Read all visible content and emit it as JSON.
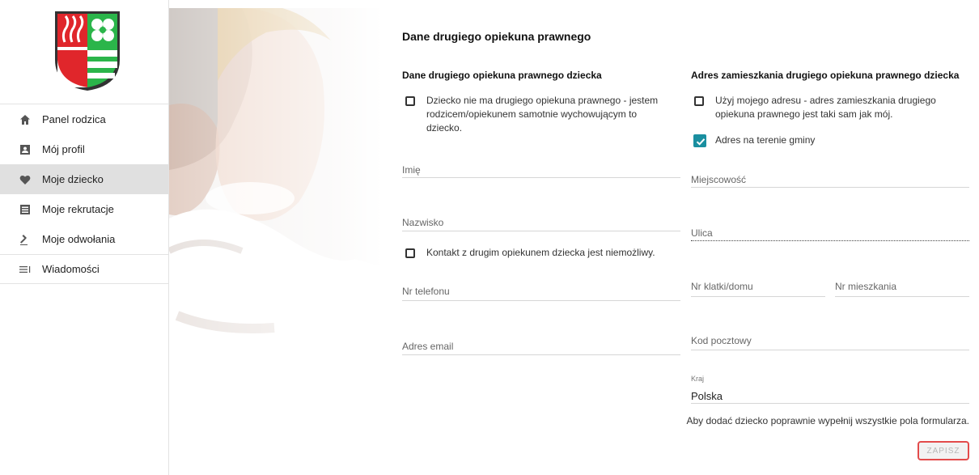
{
  "sidebar": {
    "items": [
      {
        "label": "Panel rodzica",
        "icon": "home-icon"
      },
      {
        "label": "Mój profil",
        "icon": "profile-icon"
      },
      {
        "label": "Moje dziecko",
        "icon": "heart-icon"
      },
      {
        "label": "Moje rekrutacje",
        "icon": "list-icon"
      },
      {
        "label": "Moje odwołania",
        "icon": "gavel-icon"
      },
      {
        "label": "Wiadomości",
        "icon": "messages-icon"
      }
    ]
  },
  "form": {
    "title": "Dane drugiego opiekuna prawnego",
    "left": {
      "subtitle": "Dane drugiego opiekuna prawnego dziecka",
      "no_guardian_label": "Dziecko nie ma drugiego opiekuna prawnego - jestem rodzicem/opiekunem samotnie wychowującym to dziecko.",
      "first_name_label": "Imię",
      "last_name_label": "Nazwisko",
      "no_contact_label": "Kontakt z drugim opiekunem dziecka jest niemożliwy.",
      "phone_label": "Nr telefonu",
      "email_label": "Adres email"
    },
    "right": {
      "subtitle": "Adres zamieszkania drugiego opiekuna prawnego dziecka",
      "same_address_label": "Użyj mojego adresu - adres zamieszkania drugiego opiekuna prawnego jest taki sam jak mój.",
      "in_municipality_label": "Adres na terenie gminy",
      "city_label": "Miejscowość",
      "street_label": "Ulica",
      "building_label": "Nr klatki/domu",
      "apartment_label": "Nr mieszkania",
      "postal_label": "Kod pocztowy",
      "country_label": "Kraj",
      "country_value": "Polska"
    },
    "hint": "Aby dodać dziecko poprawnie wypełnij wszystkie pola formularza.",
    "save_label": "ZAPISZ"
  },
  "colors": {
    "accent": "#1a8fa0",
    "button_border": "#e34b4b"
  }
}
